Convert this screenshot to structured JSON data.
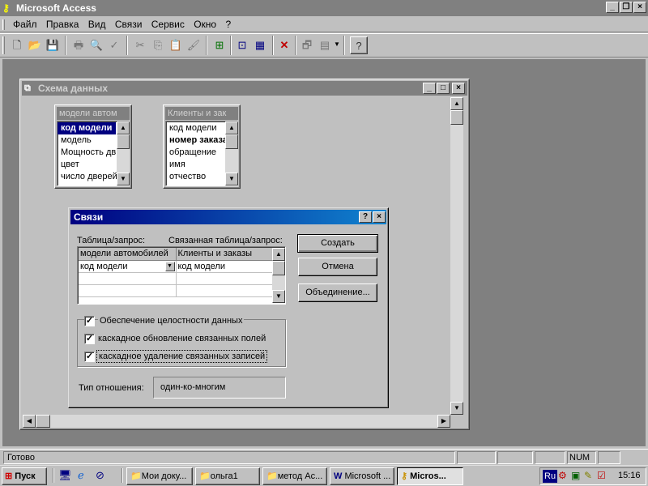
{
  "app": {
    "title": "Microsoft Access"
  },
  "menu": [
    "Файл",
    "Правка",
    "Вид",
    "Связи",
    "Сервис",
    "Окно",
    "?"
  ],
  "schema_window": {
    "title": "Схема данных",
    "tables": [
      {
        "title": "модели автом",
        "fields": [
          "код модели",
          "модель",
          "Мощность дв",
          "цвет",
          "число дверей"
        ]
      },
      {
        "title": "Клиенты и зак",
        "fields": [
          "код модели",
          "номер заказа",
          "обращение",
          "имя",
          "отчество"
        ]
      }
    ]
  },
  "dialog": {
    "title": "Связи",
    "label_table": "Таблица/запрос:",
    "label_related": "Связанная таблица/запрос:",
    "grid": {
      "col1": "модели автомобилей",
      "col2": "Клиенты и заказы",
      "row1": "код модели",
      "row1b": "код модели"
    },
    "buttons": {
      "create": "Создать",
      "cancel": "Отмена",
      "join": "Объединение..."
    },
    "integrity": "Обеспечение целостности данных",
    "cascade_update": "каскадное обновление связанных полей",
    "cascade_delete": "каскадное удаление связанных записей",
    "relation_label": "Тип отношения:",
    "relation_value": "один-ко-многим",
    "help": "?",
    "close": "×"
  },
  "status": {
    "text": "Готово",
    "num": "NUM"
  },
  "taskbar": {
    "start": "Пуск",
    "items": [
      "Мои доку...",
      "ольга1",
      "метод Ac...",
      "Microsoft ...",
      "Micros..."
    ],
    "lang": "Ru",
    "time": "15:16"
  },
  "colors": {
    "title_active": "#000080",
    "desktop": "#008080"
  }
}
